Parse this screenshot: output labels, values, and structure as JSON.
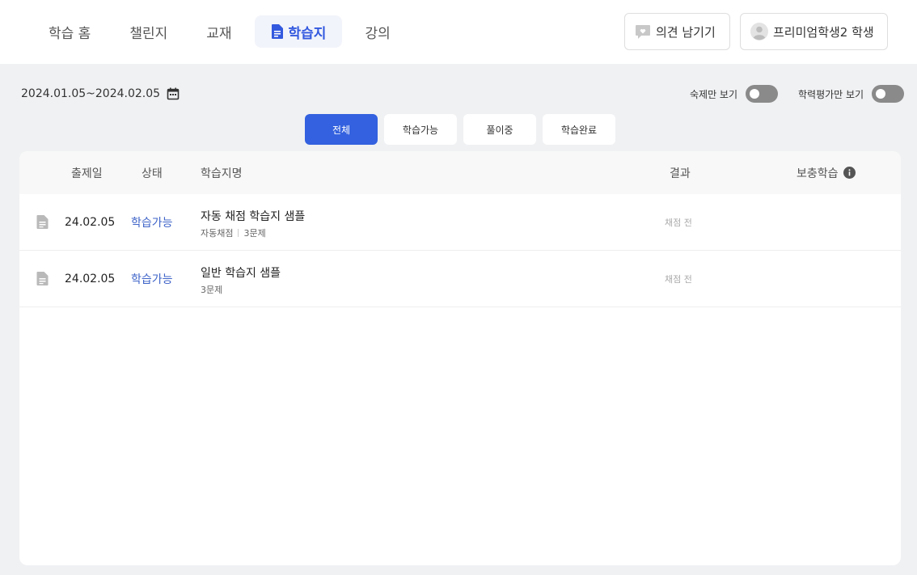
{
  "nav": {
    "items": [
      {
        "label": "학습 홈"
      },
      {
        "label": "챌린지"
      },
      {
        "label": "교재"
      },
      {
        "label": "학습지",
        "icon": "document-icon",
        "active": true
      },
      {
        "label": "강의"
      }
    ]
  },
  "header": {
    "feedback_label": "의견 남기기",
    "user_label": "프리미엄학생2 학생"
  },
  "filters": {
    "date_range": "2024.01.05~2024.02.05",
    "homework_only_label": "숙제만 보기",
    "homework_only_on": false,
    "evaluation_only_label": "학력평가만 보기",
    "evaluation_only_on": false,
    "tabs": [
      {
        "label": "전체",
        "active": true
      },
      {
        "label": "학습가능"
      },
      {
        "label": "풀이중"
      },
      {
        "label": "학습완료"
      }
    ]
  },
  "table": {
    "headers": {
      "date": "출제일",
      "status": "상태",
      "name": "학습지명",
      "result": "결과",
      "extra": "보충학습"
    },
    "rows": [
      {
        "date": "24.02.05",
        "status": "학습가능",
        "title": "자동 채점 학습지 샘플",
        "meta1": "자동채점",
        "meta2": "3문제",
        "result": "채점 전"
      },
      {
        "date": "24.02.05",
        "status": "학습가능",
        "title": "일반 학습지 샘플",
        "meta1": "3문제",
        "result": "채점 전"
      }
    ]
  },
  "colors": {
    "accent": "#3361df",
    "status_text": "#3f64c8",
    "background": "#f0f1f3"
  }
}
